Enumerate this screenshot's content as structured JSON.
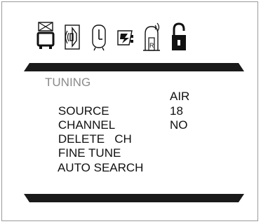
{
  "toolbar": {
    "icons": [
      {
        "name": "tv-picture-icon"
      },
      {
        "name": "speaker-sound-icon"
      },
      {
        "name": "clock-timer-icon"
      },
      {
        "name": "settings-function-icon"
      },
      {
        "name": "antenna-tuning-icon"
      },
      {
        "name": "unlocked-padlock-icon"
      }
    ]
  },
  "menu": {
    "title": "TUNING",
    "items": [
      {
        "label": "SOURCE",
        "value": "AIR"
      },
      {
        "label": "CHANNEL",
        "value": "18"
      },
      {
        "label": "DELETE   CH",
        "value": "NO"
      },
      {
        "label": "FINE TUNE",
        "value": ""
      },
      {
        "label": "AUTO SEARCH",
        "value": ""
      }
    ]
  },
  "colors": {
    "frame_border": "#9a9a9a",
    "bar_fill": "#1a1a1a",
    "title_text": "#8a8a8a",
    "item_text": "#111111"
  }
}
